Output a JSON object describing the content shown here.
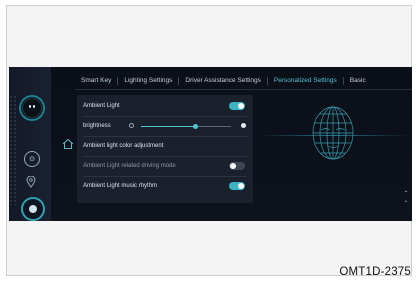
{
  "tabs": [
    {
      "label": "Smart Key",
      "active": false
    },
    {
      "label": "Lighting Settings",
      "active": false
    },
    {
      "label": "Driver Assistance Settings",
      "active": false
    },
    {
      "label": "Personalized Settings",
      "active": true
    },
    {
      "label": "Basic",
      "active": false
    }
  ],
  "panel": {
    "ambient_light": {
      "label": "Ambient Light",
      "state": "on"
    },
    "brightness": {
      "label": "brightness",
      "level_fraction": 0.6
    },
    "color_adjustment": {
      "label": "Ambient light color adjustment"
    },
    "driving_mode": {
      "label": "Ambient Light related driving mode",
      "state": "off"
    },
    "music_rhythm": {
      "label": "Ambient Light music rhythm",
      "state": "on"
    }
  },
  "figure_code": "OMT1D-2375",
  "colors": {
    "accent": "#3bb3c3",
    "screen_bg": "#0b0f18",
    "panel_bg": "#1a202c"
  },
  "icons": [
    "avatar-icon",
    "steering-icon",
    "location-icon",
    "media-icon",
    "home-icon",
    "face-scan-icon"
  ]
}
